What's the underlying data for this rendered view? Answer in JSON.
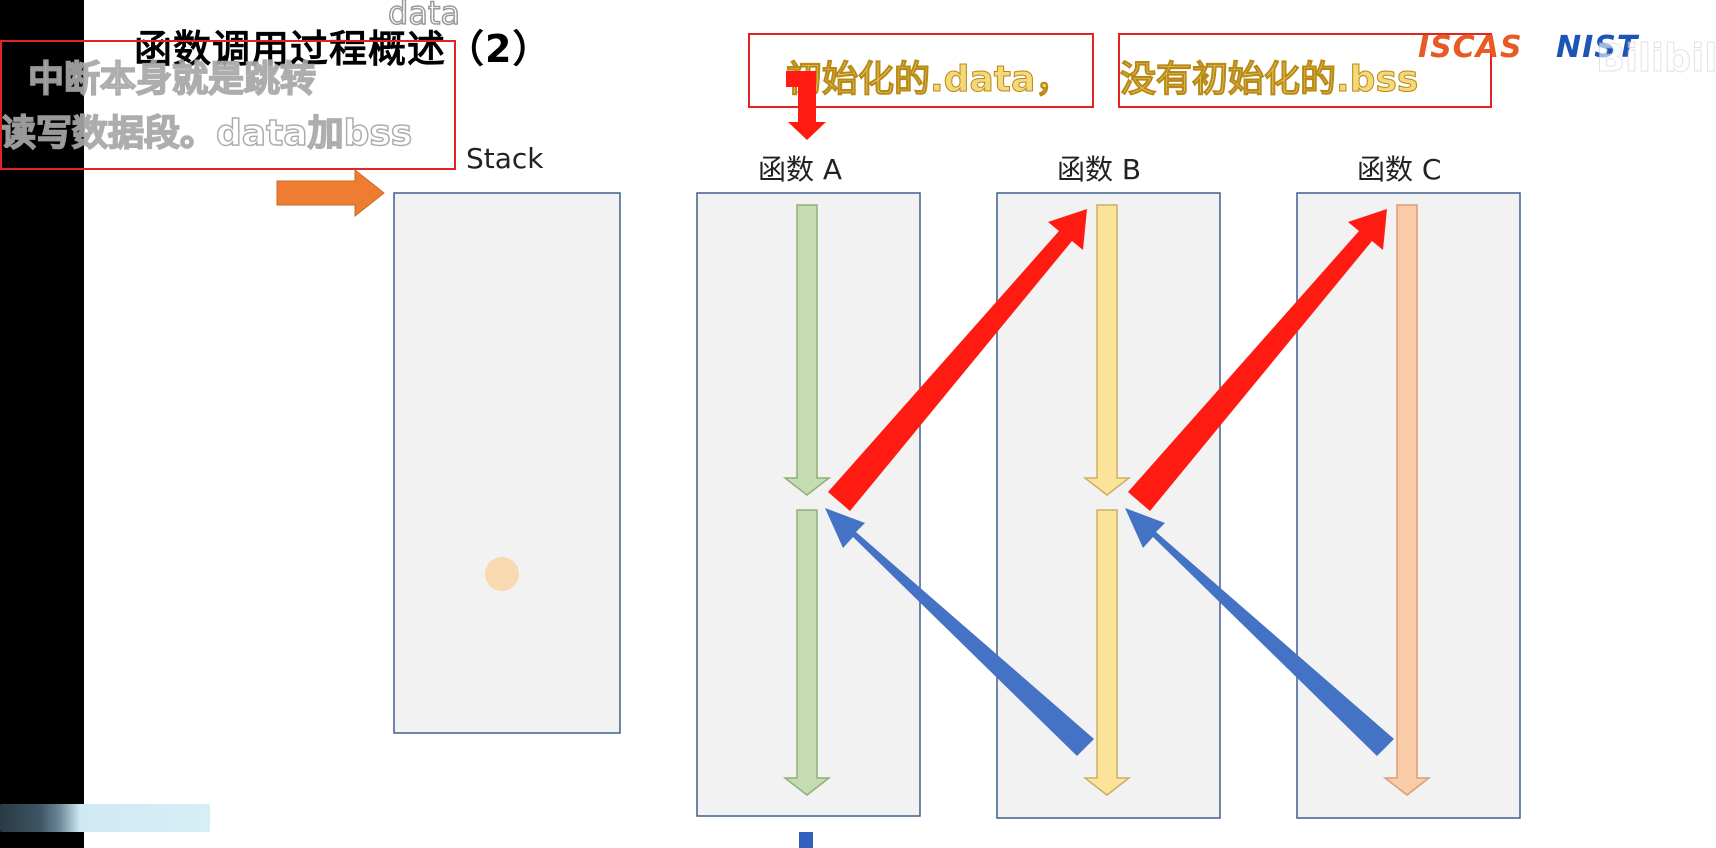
{
  "slide": {
    "title": "函数调用过程概述（2）",
    "title_overlay": "data"
  },
  "subtitles": {
    "line1": "中断本身就是跳转",
    "line2": "读写数据段。data加bss"
  },
  "captions": {
    "data": "初始化的.data，",
    "bss": "没有初始化的.bss"
  },
  "logos": {
    "iscas": "ISCAS",
    "nist": "NIST",
    "watermark": "Bilibili"
  },
  "diagram": {
    "stack_label": "Stack",
    "columns": [
      {
        "label": "函数 A",
        "arrow_color": "#c5dcb2"
      },
      {
        "label": "函数 B",
        "arrow_color": "#fbe499"
      },
      {
        "label": "函数 C",
        "arrow_color": "#f9cba7"
      }
    ],
    "call_arrow_color": "#ff1a12",
    "return_arrow_color": "#4472c4",
    "entry_arrow_color": "#ee7d31",
    "box_fill": "#f2f2f2",
    "box_stroke": "#3f5f8f"
  }
}
